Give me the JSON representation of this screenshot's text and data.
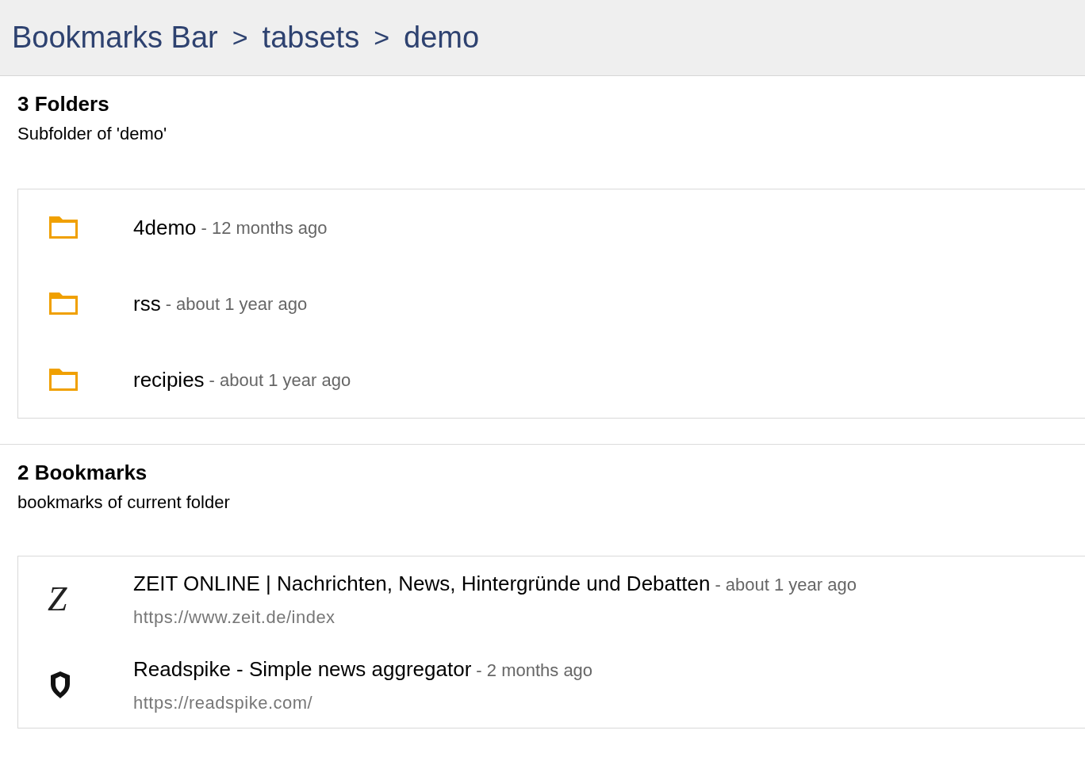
{
  "breadcrumb": [
    {
      "label": "Bookmarks Bar",
      "separator": ">"
    },
    {
      "label": "tabsets",
      "separator": ">"
    },
    {
      "label": "demo"
    }
  ],
  "folders": {
    "title": "3 Folders",
    "subtitle": "Subfolder of 'demo'",
    "items": [
      {
        "name": "4demo",
        "age": "- 12 months ago"
      },
      {
        "name": "rss",
        "age": "- about 1 year ago"
      },
      {
        "name": "recipies",
        "age": "- about 1 year ago"
      }
    ]
  },
  "bookmarks": {
    "title": "2 Bookmarks",
    "subtitle": "bookmarks of current folder",
    "items": [
      {
        "kind": "letter",
        "icon_text": "Z",
        "title": "ZEIT ONLINE | Nachrichten, News, Hintergründe und Debatten",
        "age": "- about 1 year ago",
        "url": "https://www.zeit.de/index"
      },
      {
        "kind": "shield",
        "title": "Readspike - Simple news aggregator",
        "age": "- 2 months ago",
        "url": "https://readspike.com/"
      }
    ]
  }
}
